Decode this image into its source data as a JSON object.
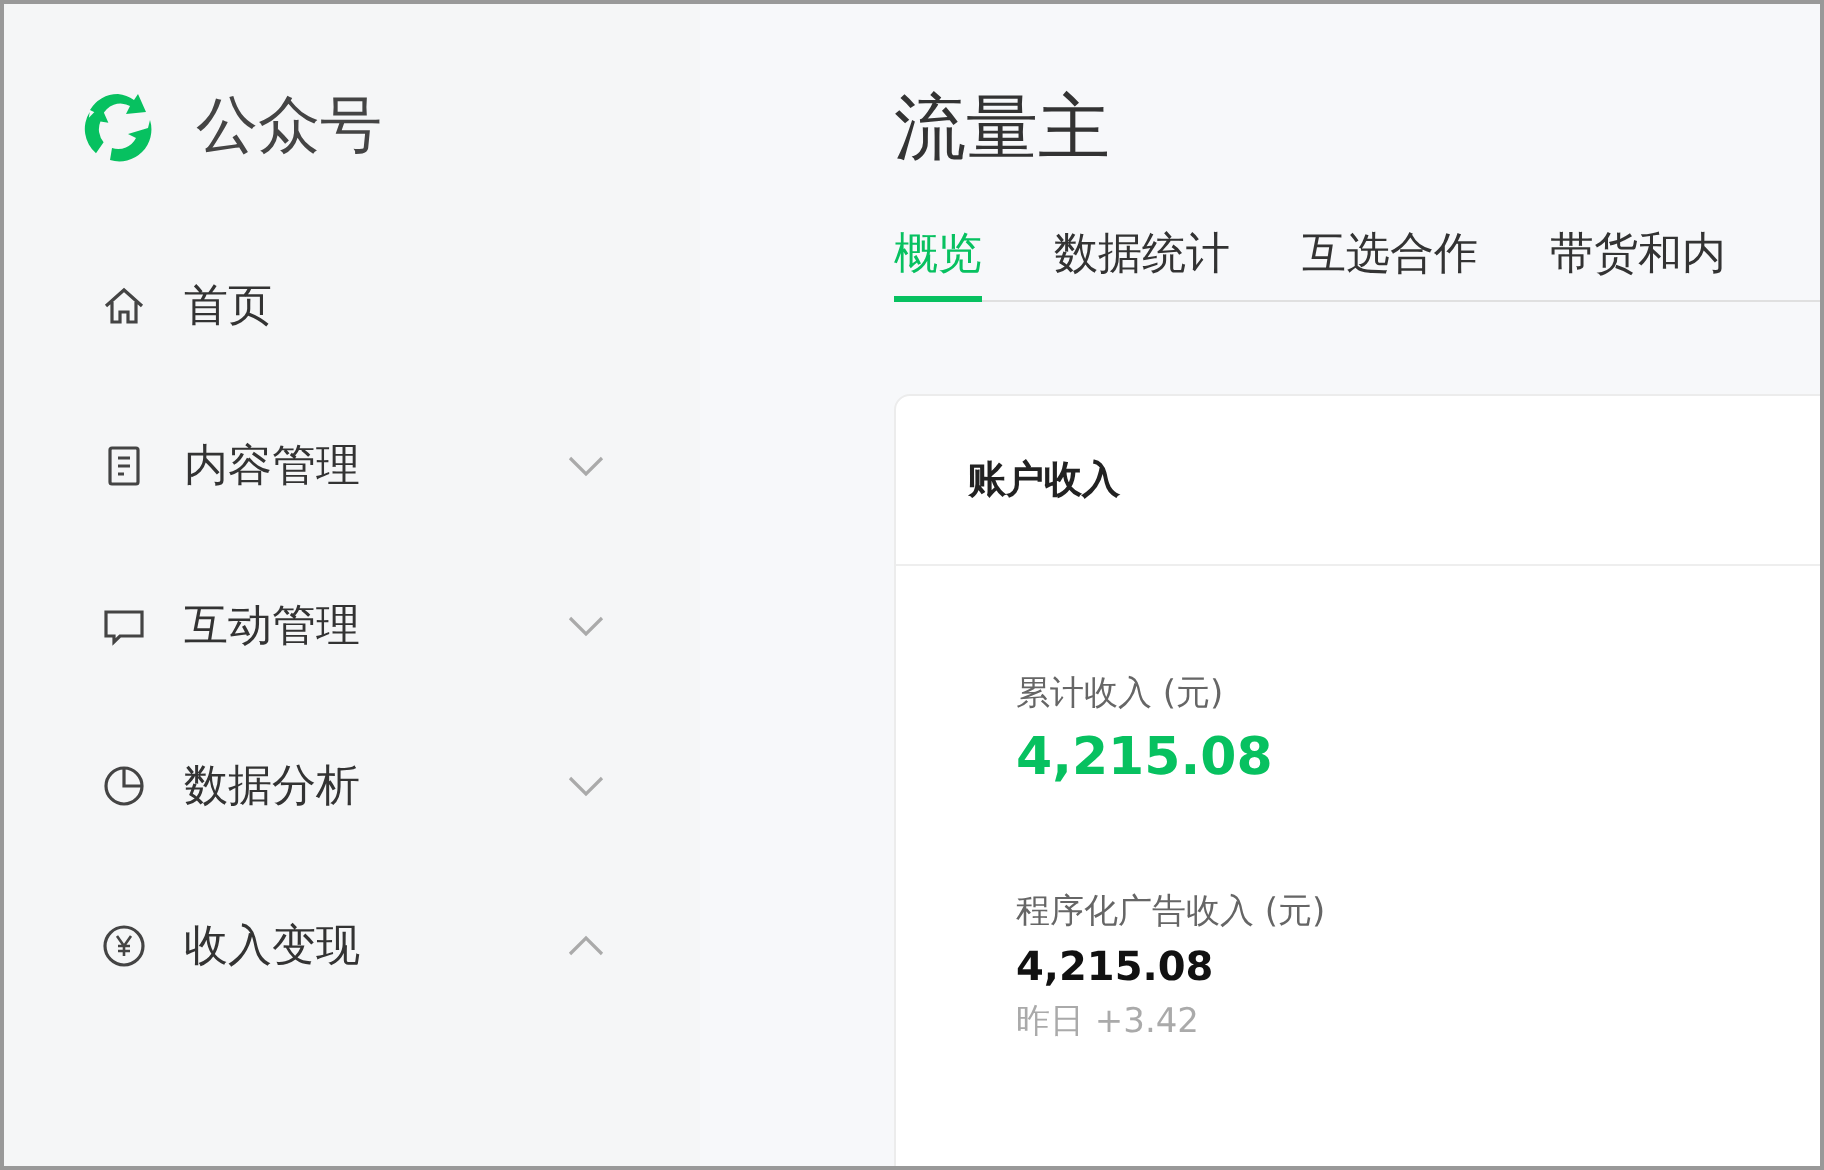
{
  "sidebar": {
    "logo_text": "公众号",
    "items": [
      {
        "label": "首页"
      },
      {
        "label": "内容管理",
        "expanded": false
      },
      {
        "label": "互动管理",
        "expanded": false
      },
      {
        "label": "数据分析",
        "expanded": false
      },
      {
        "label": "收入变现",
        "expanded": true
      }
    ]
  },
  "main": {
    "title": "流量主",
    "tabs": [
      {
        "label": "概览",
        "selected": true
      },
      {
        "label": "数据统计",
        "selected": false
      },
      {
        "label": "互选合作",
        "selected": false
      },
      {
        "label": "带货和内",
        "selected": false
      }
    ],
    "card": {
      "title": "账户收入",
      "stats": [
        {
          "label": "累计收入 (元)",
          "value": "4,215.08",
          "kind": "primary"
        },
        {
          "label": "程序化广告收入 (元)",
          "value": "4,215.08",
          "kind": "secondary",
          "note": "昨日 +3.42"
        }
      ]
    }
  }
}
